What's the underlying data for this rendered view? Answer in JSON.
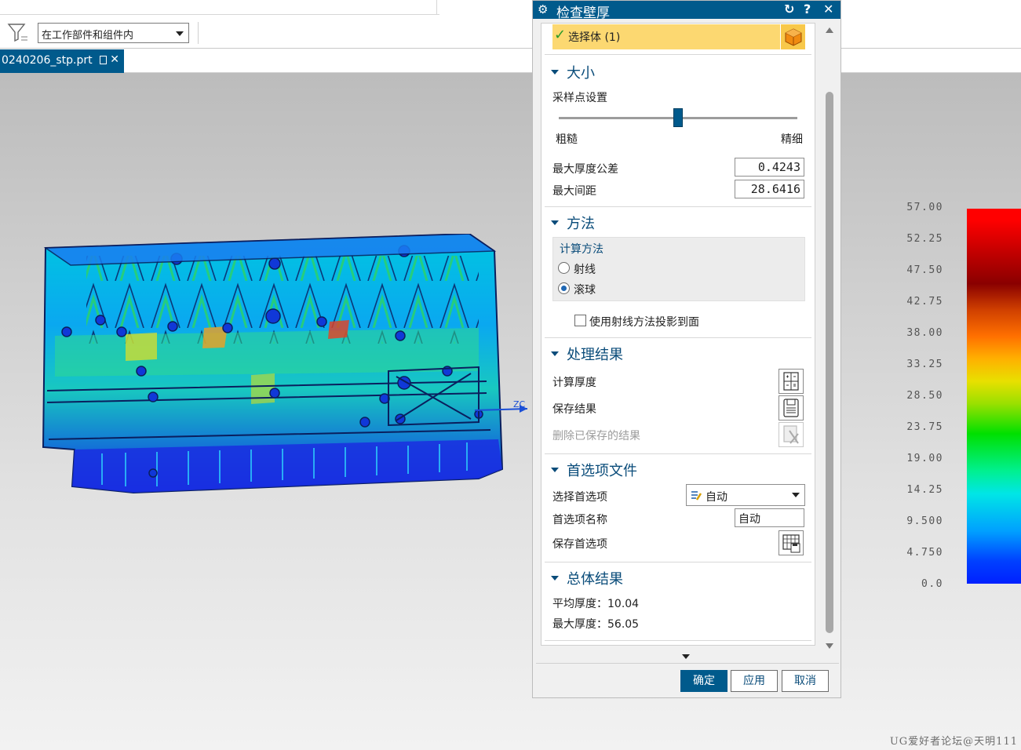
{
  "toolbar": {
    "scope_value": "在工作部件和组件内"
  },
  "file_tab": {
    "label": "0240206_stp.prt",
    "close_glyph": "✕"
  },
  "viewport": {
    "axis_label": "ZC",
    "legend": [
      "57.00",
      "52.25",
      "47.50",
      "42.75",
      "38.00",
      "33.25",
      "28.50",
      "23.75",
      "19.00",
      "14.25",
      "9.500",
      "4.750",
      "0.0"
    ],
    "watermark": "UG爱好者论坛@天明111"
  },
  "dialog": {
    "title": "检查壁厚",
    "select_body": "选择体 (1)",
    "size": {
      "header": "大小",
      "sampling_label": "采样点设置",
      "coarse": "粗糙",
      "fine": "精细",
      "slider_level": 0.5,
      "max_thickness_tol_label": "最大厚度公差",
      "max_thickness_tol_value": "0.4243",
      "max_spacing_label": "最大间距",
      "max_spacing_value": "28.6416"
    },
    "method": {
      "header": "方法",
      "calc_method_label": "计算方法",
      "option_ray": "射线",
      "option_rolling_ball": "滚球",
      "selected": "滚球",
      "project_checkbox_label": "使用射线方法投影到面",
      "project_checked": false
    },
    "processing": {
      "header": "处理结果",
      "compute_thickness": "计算厚度",
      "save_result": "保存结果",
      "delete_saved": "删除已保存的结果"
    },
    "preferences": {
      "header": "首选项文件",
      "select_pref_label": "选择首选项",
      "select_pref_value": "自动",
      "pref_name_label": "首选项名称",
      "pref_name_value": "自动",
      "save_pref_label": "保存首选项"
    },
    "summary": {
      "header": "总体结果",
      "avg_thickness": "平均厚度：10.04",
      "max_thickness": "最大厚度：56.05"
    },
    "buttons": {
      "ok": "确定",
      "apply": "应用",
      "cancel": "取消"
    }
  },
  "colors": {
    "accent": "#005a8c",
    "selection_highlight": "#fcd871",
    "section_header": "#0a4c7a"
  },
  "icons": [
    "filter-icon",
    "gear-icon",
    "reset-icon",
    "help-icon",
    "close-icon",
    "check-icon",
    "cube-icon",
    "thickness-icon",
    "save-icon",
    "delete-result-icon",
    "pref-icon",
    "save-pref-icon"
  ]
}
